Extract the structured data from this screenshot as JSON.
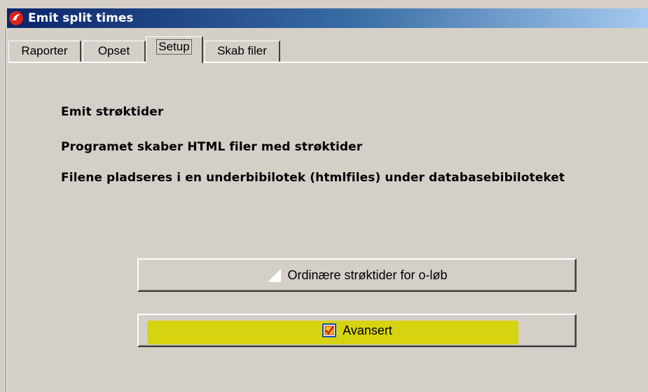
{
  "window": {
    "title": "Emit split times",
    "icon": "app-logo-icon"
  },
  "tabs": [
    {
      "label": "Raporter",
      "active": false
    },
    {
      "label": "Opset",
      "active": false
    },
    {
      "label": "Setup",
      "active": true
    },
    {
      "label": "Skab filer",
      "active": false
    }
  ],
  "content": {
    "heading1": "Emit strøktider",
    "heading2": "Programet skaber HTML filer med strøktider",
    "heading3": "Filene pladseres i en underbibilotek (htmlfiles) under databasebibiloteket"
  },
  "buttons": {
    "ordinary_label": "Ordinære strøktider for o-løb",
    "ordinary_icon": "blank-page-icon",
    "advanced_label": "Avansert",
    "advanced_icon": "checkbox-icon",
    "highlight_color": "#d6d400"
  }
}
